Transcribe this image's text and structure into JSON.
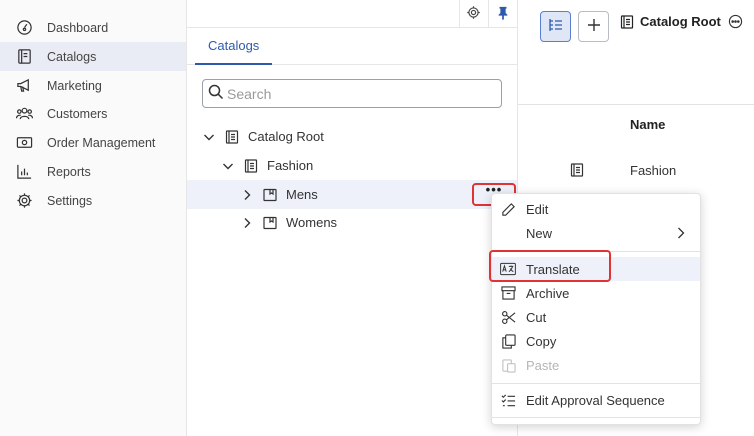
{
  "sidebar": {
    "items": [
      {
        "label": "Dashboard",
        "icon": "dashboard-gauge-icon"
      },
      {
        "label": "Catalogs",
        "icon": "catalog-book-icon",
        "active": true
      },
      {
        "label": "Marketing",
        "icon": "megaphone-icon"
      },
      {
        "label": "Customers",
        "icon": "users-icon"
      },
      {
        "label": "Order Management",
        "icon": "money-icon"
      },
      {
        "label": "Reports",
        "icon": "bar-chart-icon"
      },
      {
        "label": "Settings",
        "icon": "gear-icon"
      }
    ]
  },
  "tree_panel": {
    "tab_label": "Catalogs",
    "search_placeholder": "Search",
    "nodes": [
      {
        "label": "Catalog Root",
        "expanded": true
      },
      {
        "label": "Fashion",
        "expanded": true
      },
      {
        "label": "Mens",
        "expanded": false,
        "selected": true
      },
      {
        "label": "Womens",
        "expanded": false
      }
    ],
    "more_label": "•••"
  },
  "right_panel": {
    "title": "Catalog Root",
    "column_header": "Name",
    "rows": [
      {
        "name": "Fashion"
      }
    ]
  },
  "context_menu": {
    "items": [
      {
        "label": "Edit",
        "icon": "pencil-icon"
      },
      {
        "label": "New",
        "icon": "",
        "submenu": true
      },
      {
        "label": "Translate",
        "icon": "translate-icon"
      },
      {
        "label": "Archive",
        "icon": "archive-icon"
      },
      {
        "label": "Cut",
        "icon": "scissors-icon"
      },
      {
        "label": "Copy",
        "icon": "copy-icon"
      },
      {
        "label": "Paste",
        "icon": "paste-icon",
        "disabled": true
      },
      {
        "label": "Edit Approval Sequence",
        "icon": "checklist-icon"
      }
    ]
  },
  "colors": {
    "accent": "#2e5aac",
    "highlight": "#e03434",
    "selected_bg": "#eef1fa"
  }
}
